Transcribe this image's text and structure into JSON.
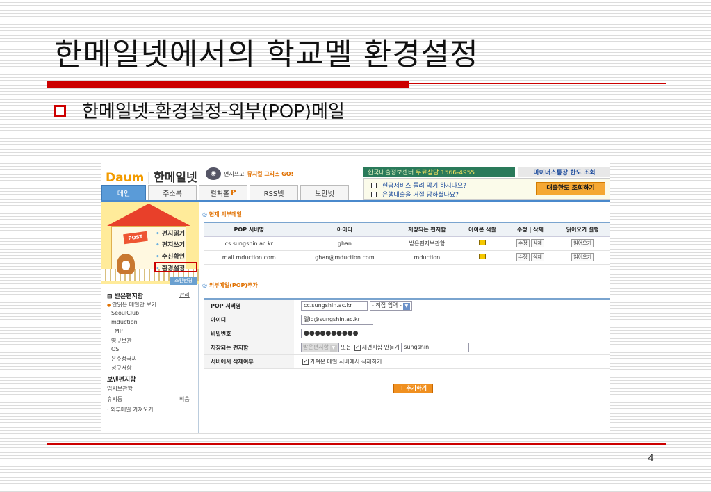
{
  "slide": {
    "title": "한메일넷에서의 학교멜 환경설정",
    "bullet": "한메일넷-환경설정-외부(POP)메일",
    "page_number": "4",
    "accent_color": "#cc0000"
  },
  "app": {
    "logo_brand": "Daum",
    "logo_name": "한메일넷",
    "promo_text": "편지쓰고",
    "promo_link": "뮤지컬 그리스 GO!",
    "tabs": [
      {
        "label": "메인",
        "active": true
      },
      {
        "label": "주소록",
        "active": false
      },
      {
        "label": "컬쳐홀",
        "badge": "P",
        "active": false
      },
      {
        "label": "RSS넷",
        "active": false
      },
      {
        "label": "보안넷",
        "active": false
      }
    ],
    "banner_left": "한국대출정보센터",
    "banner_phone": "무료상담 1566-4955",
    "banner_right": "마이너스통장 한도 조회",
    "ad_line1": "현금서비스 돌려 막기 하시나요?",
    "ad_line2": "은행대출을 거절 당하셨나요?",
    "ad_button": "대출한도 조회하기"
  },
  "sidebar": {
    "post_sign": "POST",
    "menu": [
      "편지읽기",
      "편지쓰기",
      "수신확인",
      "환경설정"
    ],
    "skin_button": "스킨변경",
    "inbox_title": "받은편지함",
    "manage_link": "관리",
    "folders": [
      "안읽은 메일만 보기",
      "SeoulClub",
      "mduction",
      "TMP",
      "영구보관",
      "OS",
      "은주성국씨",
      "청구서함"
    ],
    "sent": "보낸편지함",
    "temp": "임시보관함",
    "trash": "휴지통",
    "empty_link": "비움",
    "external": "외부메일 가져오기"
  },
  "current_external": {
    "section_title": "현재 외부메일",
    "headers": [
      "POP 서버명",
      "아이디",
      "저장되는 편지함",
      "아이콘 색깔",
      "수정 | 삭제",
      "읽어오기 설행"
    ],
    "rows": [
      {
        "server": "cs.sungshin.ac.kr",
        "id": "ghan",
        "folder": "받은편지보관함",
        "edit": "수정",
        "delete": "삭제",
        "fetch": "읽어오기"
      },
      {
        "server": "mail.mduction.com",
        "id": "ghan@mduction.com",
        "folder": "mduction",
        "edit": "수정",
        "delete": "삭제",
        "fetch": "읽어오기"
      }
    ]
  },
  "add_external": {
    "section_title": "외부메일(POP)추가",
    "server_label": "POP 서버명",
    "server_value": "cc.sungshin.ac.kr",
    "server_select": "- 직접 입력 -",
    "id_label": "아이디",
    "id_value": "멜id@sungshin.ac.kr",
    "password_label": "비밀번호",
    "password_value": "●●●●●●●●●●",
    "folder_label": "저장되는 편지함",
    "folder_select": "받은편지함",
    "or_text": "또는",
    "new_folder_text": "새편지함 만들기",
    "new_folder_value": "sungshin",
    "delete_label": "서버에서 삭제여부",
    "delete_text": "가져온 메일 서버에서 삭제하기",
    "add_button": "+ 추가하기"
  }
}
